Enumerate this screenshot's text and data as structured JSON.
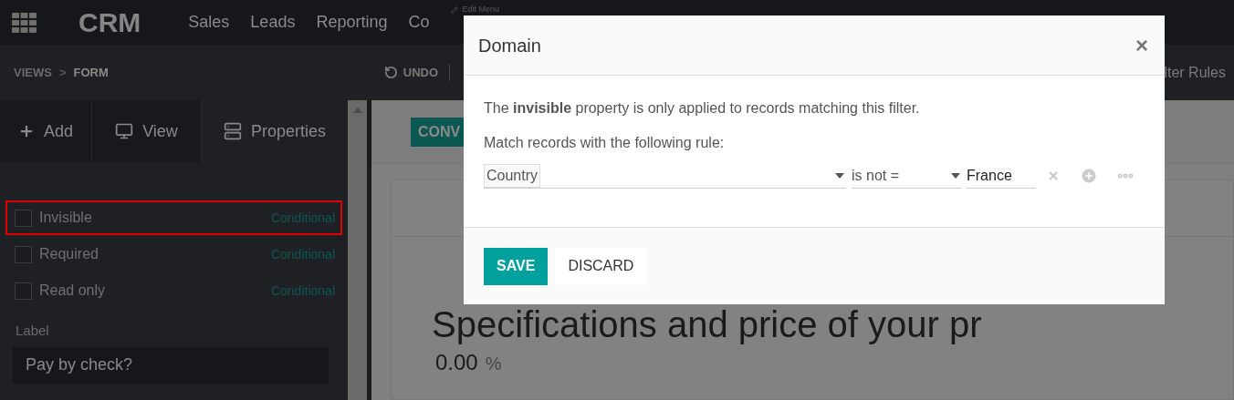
{
  "top_nav": {
    "app": "CRM",
    "menu": [
      "Sales",
      "Leads",
      "Reporting",
      "Co"
    ],
    "edit_menu": "Edit Menu"
  },
  "toolbar": {
    "breadcrumb": [
      "VIEWS",
      "FORM"
    ],
    "separator": ">",
    "undo": "UNDO",
    "right": "lter Rules"
  },
  "sidebar": {
    "tabs": [
      {
        "label": "Add",
        "kind": "add",
        "selected": false
      },
      {
        "label": "View",
        "kind": "view",
        "selected": false
      },
      {
        "label": "Properties",
        "kind": "properties",
        "selected": true
      }
    ],
    "properties": [
      {
        "label": "Invisible",
        "checked": false,
        "highlighted": true,
        "action": "Conditional"
      },
      {
        "label": "Required",
        "checked": false,
        "highlighted": false,
        "action": "Conditional"
      },
      {
        "label": "Read only",
        "checked": false,
        "highlighted": false,
        "action": "Conditional"
      }
    ],
    "label_field": {
      "label": "Label",
      "value": "Pay by check?"
    }
  },
  "form": {
    "button": "CONV",
    "title": "Specifications and price of your pr",
    "value": "0.00",
    "unit": "%"
  },
  "dialog": {
    "title": "Domain",
    "close": "×",
    "description": "The **invisible** property is only applied to records matching this filter.",
    "rule_intro": "Match records with the following rule:",
    "rule": {
      "field": "Country",
      "operator": "is not =",
      "value": "France"
    },
    "buttons": [
      {
        "label": "SAVE",
        "kind": "primary"
      },
      {
        "label": "DISCARD",
        "kind": "secondary"
      }
    ]
  }
}
